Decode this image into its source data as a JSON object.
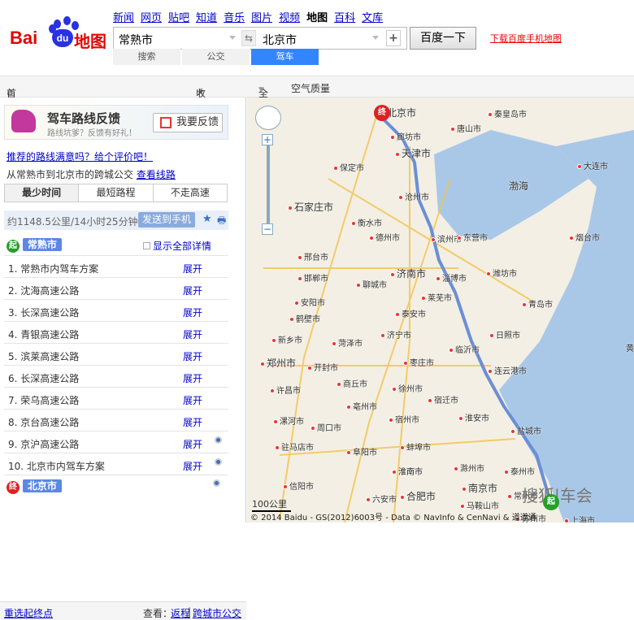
{
  "logo": {
    "text": "Bai du 地图"
  },
  "nav": [
    "新闻",
    "网页",
    "贴吧",
    "知道",
    "音乐",
    "图片",
    "视频",
    "地图",
    "百科",
    "文库"
  ],
  "nav_current": "地图",
  "search": {
    "from": "常熟市",
    "to": "北京市",
    "button": "百度一下",
    "download": "下载百度手机地图"
  },
  "modes": [
    {
      "label": "搜索",
      "active": false
    },
    {
      "label": "公交",
      "active": false
    },
    {
      "label": "驾车",
      "active": true
    }
  ],
  "toolbar": {
    "home": "首页",
    "favorites": "收藏夹",
    "region": "全国",
    "air": "空气质量"
  },
  "banner": {
    "title": "驾车路线反馈",
    "subtitle": "路线坑爹？反馈有好礼！",
    "button": "我要反馈"
  },
  "rate_link": "推荐的路线满意吗？给个评价吧！",
  "from_text": "从常熟市到北京市的跨城公交",
  "view_route": "查看线路",
  "tabs": [
    {
      "label": "最少时间",
      "active": true
    },
    {
      "label": "最短路程",
      "active": false
    },
    {
      "label": "不走高速",
      "active": false
    }
  ],
  "summary": {
    "distance_time": "约1148.5公里/14小时25分钟",
    "send": "发送到手机"
  },
  "start": {
    "badge": "起",
    "city": "常熟市",
    "show_all": "显示全部详情"
  },
  "steps": [
    {
      "label": "1. 常熟市内驾车方案",
      "action": "展开",
      "pin": false
    },
    {
      "label": "2. 沈海高速公路",
      "action": "展开",
      "pin": false
    },
    {
      "label": "3. 长深高速公路",
      "action": "展开",
      "pin": false
    },
    {
      "label": "4. 青银高速公路",
      "action": "展开",
      "pin": false
    },
    {
      "label": "5. 滨莱高速公路",
      "action": "展开",
      "pin": false
    },
    {
      "label": "6. 长深高速公路",
      "action": "展开",
      "pin": false
    },
    {
      "label": "7. 荣乌高速公路",
      "action": "展开",
      "pin": false
    },
    {
      "label": "8. 京台高速公路",
      "action": "展开",
      "pin": false
    },
    {
      "label": "9. 京沪高速公路",
      "action": "展开",
      "pin": true
    },
    {
      "label": "10. 北京市内驾车方案",
      "action": "展开",
      "pin": true
    }
  ],
  "end": {
    "badge": "终",
    "city": "北京市"
  },
  "footer": {
    "reselect": "重选起终点",
    "view": "查看：",
    "return": "返程",
    "intercity": "跨城市公交"
  },
  "map": {
    "cities": [
      "北京市",
      "秦皇岛市",
      "唐山市",
      "廊坊市",
      "天津市",
      "保定市",
      "大连市",
      "沧州市",
      "渤海",
      "石家庄市",
      "衡水市",
      "德州市",
      "滨州市",
      "东营市",
      "烟台市",
      "邢台市",
      "济南市",
      "淄博市",
      "潍坊市",
      "邯郸市",
      "聊城市",
      "莱芜市",
      "青岛市",
      "安阳市",
      "泰安市",
      "鹤壁市",
      "日照市",
      "新乡市",
      "济宁市",
      "临沂市",
      "菏泽市",
      "郑州市",
      "枣庄市",
      "连云港市",
      "开封市",
      "商丘市",
      "徐州市",
      "宿迁市",
      "许昌市",
      "亳州市",
      "盐城市",
      "漯河市",
      "宿州市",
      "淮安市",
      "周口市",
      "蚌埠市",
      "驻马店市",
      "阜阳市",
      "滁州市",
      "泰州市",
      "淮南市",
      "信阳市",
      "南京市",
      "合肥市",
      "六安市",
      "马鞍山市",
      "常州市",
      "苏州市",
      "上海市",
      "淮南市",
      "黄"
    ],
    "scale": "100公里",
    "copyright": "© 2014 Baidu - GS(2012)6003号 - Data © NavInfo & CenNavi & 道道通",
    "watermark": "搜狐|车会",
    "route_color": "#6b8fd6",
    "end_marker": "终",
    "start_marker": "起"
  }
}
